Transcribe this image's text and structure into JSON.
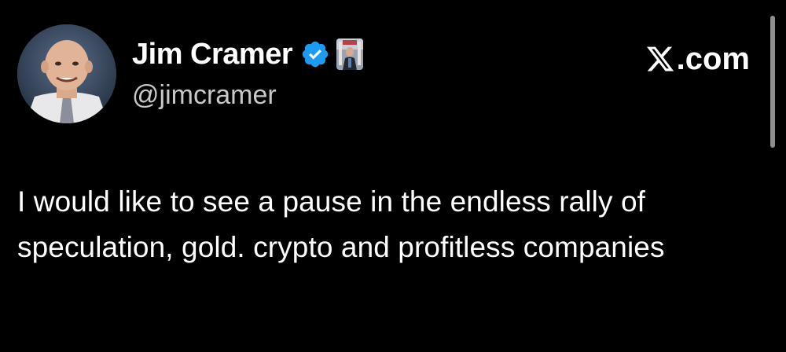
{
  "author": {
    "display_name": "Jim Cramer",
    "handle": "@jimcramer",
    "verified_icon": "verified-badge-icon",
    "affiliate_badge": "affiliate-badge-image"
  },
  "site": {
    "label": ".com",
    "logo_icon": "x-logo-icon"
  },
  "tweet": {
    "text": "I would like to see a pause in the endless rally of speculation, gold. crypto and profitless companies"
  },
  "colors": {
    "background": "#000000",
    "text_primary": "#ffffff",
    "text_secondary": "#c8c8c8",
    "verified_blue": "#1d9bf0",
    "scrollbar": "#8e8e8e"
  }
}
